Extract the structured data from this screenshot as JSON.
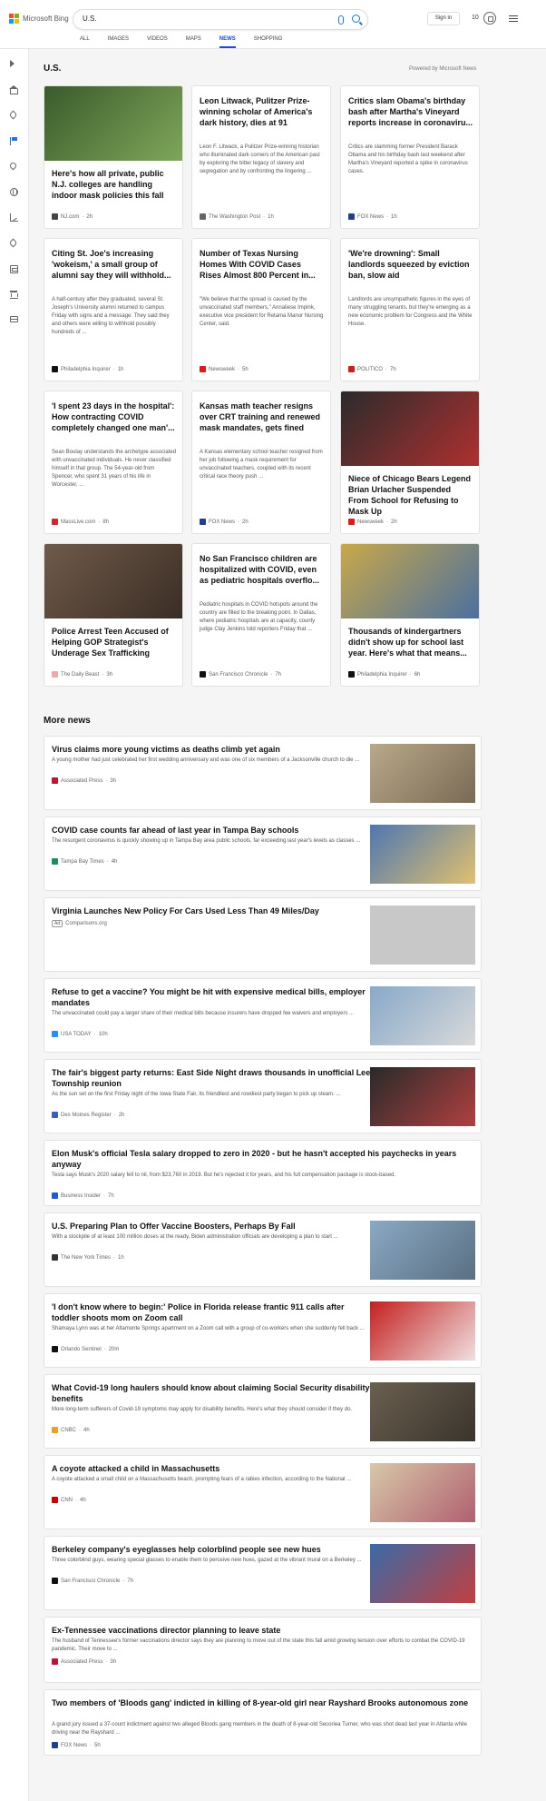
{
  "header": {
    "logo_text": "Microsoft Bing",
    "search_value": "U.S.",
    "signin_label": "Sign in",
    "rewards_count": "10",
    "ms_colors": [
      "#f25022",
      "#7fba00",
      "#00a4ef",
      "#ffb900"
    ]
  },
  "nav": {
    "tabs": [
      {
        "label": "ALL",
        "active": false
      },
      {
        "label": "IMAGES",
        "active": false
      },
      {
        "label": "VIDEOS",
        "active": false
      },
      {
        "label": "MAPS",
        "active": false
      },
      {
        "label": "NEWS",
        "active": true
      },
      {
        "label": "SHOPPING",
        "active": false
      }
    ]
  },
  "rail": {
    "icons": [
      "collapse-arrow-icon",
      "home-icon",
      "trending-icon",
      "flag-icon",
      "location-pin-icon",
      "globe-icon",
      "chart-icon",
      "sports-icon",
      "entertainment-icon",
      "bank-icon",
      "card-icon"
    ]
  },
  "section": {
    "title": "U.S.",
    "powered_by": "Powered by Microsoft News"
  },
  "cards": [
    {
      "title": "Here's how all private, public N.J. colleges are handling indoor mask policies this fall",
      "desc": "",
      "source": "NJ.com",
      "time": "2h",
      "logo_color": "#444444",
      "image": true,
      "img_colors": [
        "#3a5b2c",
        "#7fa75a"
      ]
    },
    {
      "title": "Leon Litwack, Pulitzer Prize-winning scholar of America's dark history, dies at 91",
      "desc": "Leon F. Litwack, a Pulitzer Prize-winning historian who illuminated dark corners of the American past by exploring the bitter legacy of slavery and segregation and by confronting the lingering ...",
      "source": "The Washington Post",
      "time": "1h",
      "logo_color": "#666666",
      "image": false
    },
    {
      "title": "Critics slam Obama's birthday bash after Martha's Vineyard reports increase in coronaviru...",
      "desc": "Critics are slamming former President Barack Obama and his birthday bash last weekend after Martha's Vineyard reported a spike in coronavirus cases.",
      "source": "FOX News",
      "time": "1h",
      "logo_color": "#1f3f8f",
      "image": false
    },
    {
      "title": "Citing St. Joe's increasing 'wokeism,' a small group of alumni say they will withhold...",
      "desc": "A half-century after they graduated, several St. Joseph's University alumni returned to campus Friday with signs and a message: They said they and others were willing to withhold possibly hundreds of ...",
      "source": "Philadelphia Inquirer",
      "time": "1h",
      "logo_color": "#111111",
      "image": false
    },
    {
      "title": "Number of Texas Nursing Homes With COVID Cases Rises Almost 800 Percent in...",
      "desc": "\"We believe that the spread is caused by the unvaccinated staff members,\" Annaliese Impink, executive vice president for Retama Manor Nursing Center, said.",
      "source": "Newsweek",
      "time": "5h",
      "logo_color": "#e01a1a",
      "image": false
    },
    {
      "title": "'We're drowning': Small landlords squeezed by eviction ban, slow aid",
      "desc": "Landlords are unsympathetic figures in the eyes of many struggling tenants, but they're emerging as a new economic problem for Congress and the White House.",
      "source": "POLITICO",
      "time": "7h",
      "logo_color": "#d11c1c",
      "image": false
    },
    {
      "title": "'I spent 23 days in the hospital': How contracting COVID completely changed one man'...",
      "desc": "Sean Boulay understands the archetype associated with unvaccinated individuals. He never classified himself in that group. The 54-year-old from Spencer, who spent 31 years of his life in Worcester, ...",
      "source": "MassLive.com",
      "time": "8h",
      "logo_color": "#d8252c",
      "image": false
    },
    {
      "title": "Kansas math teacher resigns over CRT training and renewed mask mandates, gets fined",
      "desc": "A Kansas elementary school teacher resigned from her job following a mask requirement for unvaccinated teachers, coupled with its recent critical race theory push ...",
      "source": "FOX News",
      "time": "2h",
      "logo_color": "#1f3f8f",
      "image": false
    },
    {
      "title": "Niece of Chicago Bears Legend Brian Urlacher Suspended From School for Refusing to Mask Up",
      "desc": "",
      "source": "Newsweek",
      "time": "2h",
      "logo_color": "#e01a1a",
      "image": true,
      "img_colors": [
        "#2b2b2b",
        "#b03030"
      ]
    },
    {
      "title": "Police Arrest Teen Accused of Helping GOP Strategist's Underage Sex Trafficking",
      "desc": "",
      "source": "The Daily Beast",
      "time": "3h",
      "logo_color": "#f3a8a8",
      "image": true,
      "img_colors": [
        "#6f5a4a",
        "#3a2d24"
      ]
    },
    {
      "title": "No San Francisco children are hospitalized with COVID, even as pediatric hospitals overflo...",
      "desc": "Pediatric hospitals in COVID hotspots around the country are filled to the breaking point. In Dallas, where pediatric hospitals are at capacity, county judge Clay Jenkins told reporters Friday that ...",
      "source": "San Francisco Chronicle",
      "time": "7h",
      "logo_color": "#111111",
      "image": false
    },
    {
      "title": "Thousands of kindergartners didn't show up for school last year. Here's what that means...",
      "desc": "",
      "source": "Philadelphia Inquirer",
      "time": "6h",
      "logo_color": "#111111",
      "image": true,
      "img_colors": [
        "#c9a84a",
        "#4a6fa0"
      ]
    }
  ],
  "more_news": {
    "title": "More news",
    "items": [
      {
        "headline": "Virus claims more young victims as deaths climb yet again",
        "desc": "A young mother had just celebrated her first wedding anniversary and was one of six members of a Jacksonville church to die ...",
        "source": "Associated Press",
        "time": "3h",
        "logo_color": "#c8102e",
        "image": true,
        "img_colors": [
          "#b8a98a",
          "#7a6a55"
        ]
      },
      {
        "headline": "COVID case counts far ahead of last year in Tampa Bay schools",
        "desc": "The resurgent coronavirus is quickly showing up in Tampa Bay area public schools, far exceeding last year's levels as classes ...",
        "source": "Tampa Bay Times",
        "time": "4h",
        "logo_color": "#1c8f5e",
        "image": true,
        "img_colors": [
          "#4e77b0",
          "#e0c070"
        ]
      },
      {
        "headline": "Virginia Launches New Policy For Cars Used Less Than 49 Miles/Day",
        "desc": "",
        "source": "Comparisons.org",
        "time": "",
        "ad": "Ad",
        "logo_color": "#999999",
        "image": true,
        "img_colors": [
          "#c8c8c8",
          "#c8c8c8"
        ]
      },
      {
        "headline": "Refuse to get a vaccine? You might be hit with expensive medical bills, employer mandates",
        "desc": "The unvaccinated could pay a larger share of their medical bills because insurers have dropped fee waivers and employers ...",
        "source": "USA TODAY",
        "time": "10h",
        "logo_color": "#1e90ff",
        "image": true,
        "img_colors": [
          "#87a9c9",
          "#d9d9d9"
        ]
      },
      {
        "headline": "The fair's biggest party returns: East Side Night draws thousands in unofficial Lee Township reunion",
        "desc": "As the sun set on the first Friday night of the Iowa State Fair, its friendliest and rowdiest party began to pick up steam. ...",
        "source": "Des Moines Register",
        "time": "2h",
        "logo_color": "#3a5bc8",
        "image": true,
        "img_colors": [
          "#2a2a2a",
          "#b04040"
        ]
      },
      {
        "headline": "Elon Musk's official Tesla salary dropped to zero in 2020 - but he hasn't accepted his paychecks in years anyway",
        "desc": "Tesla says Musk's 2020 salary fell to nil, from $23,760 in 2019. But he's rejected it for years, and his full compensation package is stock-based.",
        "source": "Business Insider",
        "time": "7h",
        "logo_color": "#1e5bd8",
        "image": false
      },
      {
        "headline": "U.S. Preparing Plan to Offer Vaccine Boosters, Perhaps By Fall",
        "desc": "With a stockpile of at least 100 million doses at the ready, Biden administration officials are developing a plan to start ...",
        "source": "The New York Times",
        "time": "1h",
        "logo_color": "#333333",
        "image": true,
        "img_colors": [
          "#8aa9c4",
          "#5a6f82"
        ]
      },
      {
        "headline": "'I don't know where to begin:' Police in Florida release frantic 911 calls after toddler shoots mom on Zoom call",
        "desc": "Shamaya Lynn was at her Altamonte Springs apartment on a Zoom call with a group of co-workers when she suddenly fell back ...",
        "source": "Orlando Sentinel",
        "time": "20m",
        "logo_color": "#111111",
        "image": true,
        "img_colors": [
          "#c42020",
          "#f0e0e0"
        ]
      },
      {
        "headline": "What Covid-19 long haulers should know about claiming Social Security disability benefits",
        "desc": "More long-term sufferers of Covid-19 symptoms may apply for disability benefits. Here's what they should consider if they do.",
        "source": "CNBC",
        "time": "4h",
        "logo_color": "#f0a020",
        "image": true,
        "img_colors": [
          "#6a6050",
          "#3a342c"
        ]
      },
      {
        "headline": "A coyote attacked a child in Massachusetts",
        "desc": "A coyote attacked a small child on a Massachusetts beach, prompting fears of a rabies infection, according to the National ...",
        "source": "CNN",
        "time": "4h",
        "logo_color": "#cc0000",
        "image": true,
        "img_colors": [
          "#d8c8a8",
          "#b06070"
        ]
      },
      {
        "headline": "Berkeley company's eyeglasses help colorblind people see new hues",
        "desc": "Three colorblind guys, wearing special glasses to enable them to perceive new hues, gazed at the vibrant mural on a Berkeley ...",
        "source": "San Francisco Chronicle",
        "time": "7h",
        "logo_color": "#111111",
        "image": true,
        "img_colors": [
          "#3a6aa8",
          "#c04040"
        ]
      },
      {
        "headline": "Ex-Tennessee vaccinations director planning to leave state",
        "desc": "The husband of Tennessee's former vaccinations director says they are planning to move out of the state this fall amid growing tension over efforts to combat the COVID-19 pandemic. Their move to ...",
        "source": "Associated Press",
        "time": "3h",
        "logo_color": "#c8102e",
        "image": false
      },
      {
        "headline": "Two members of 'Bloods gang' indicted in killing of 8-year-old girl near Rayshard Brooks autonomous zone",
        "desc": "A grand jury issued a 37-count indictment against two alleged Bloods gang members in the death of 8-year-old Secoriea Turner, who was shot dead last year in Atlanta while driving near the Rayshard ...",
        "source": "FOX News",
        "time": "5h",
        "logo_color": "#1f3f8f",
        "image": false
      }
    ]
  }
}
